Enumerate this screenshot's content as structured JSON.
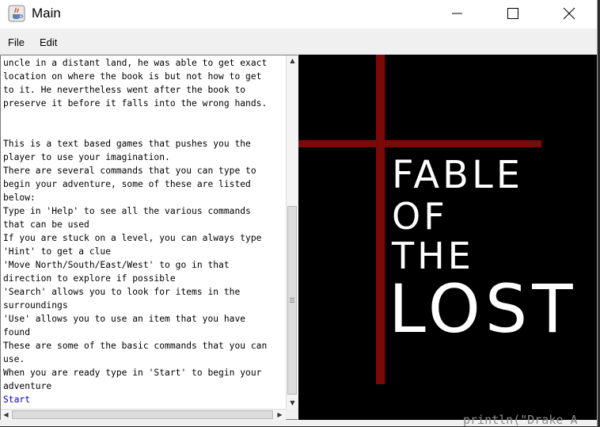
{
  "window": {
    "title": "Main"
  },
  "menubar": {
    "items": [
      "File",
      "Edit"
    ]
  },
  "text_area": {
    "lines": [
      "uncle in a distant land, he was able to get exact",
      "location on where the book is but not how to get",
      "to it. He nevertheless went after the book to",
      "preserve it before it falls into the wrong hands.",
      "",
      "",
      "This is a text based games that pushes you the",
      "player to use your imagination.",
      "There are several commands that you can type to",
      "begin your adventure, some of these are listed",
      "below:",
      "Type in 'Help' to see all the various commands",
      "that can be used",
      "If you are stuck on a level, you can always type",
      "'Hint' to get a clue",
      "'Move North/South/East/West' to go in that",
      "direction to explore if possible",
      "'Search' allows you to look for items in the",
      "surroundings",
      "'Use' allows you to use an item that you have",
      "found",
      "These are some of the basic commands that you can",
      "use.",
      "When you are ready type in 'Start' to begin your",
      "adventure"
    ],
    "user_input": "Start"
  },
  "title_art": {
    "lines": [
      "FABLE",
      "OF",
      "THE",
      "LOST"
    ],
    "cross_color": "#7a0a0a",
    "text_color": "#ffffff",
    "background": "#000000"
  },
  "background_code": "println(\"Drake A"
}
